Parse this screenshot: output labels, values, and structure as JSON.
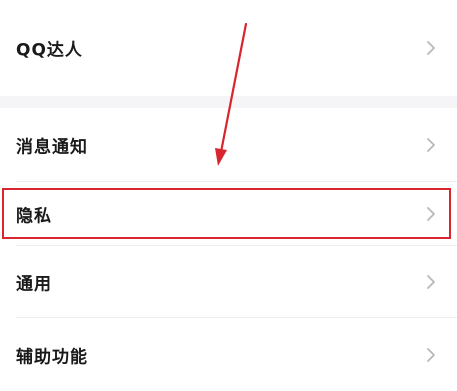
{
  "settings": {
    "items": [
      {
        "label": "QQ达人",
        "icon": "chevron-right-icon"
      },
      {
        "label": "消息通知",
        "icon": "chevron-right-icon"
      },
      {
        "label": "隐私",
        "icon": "chevron-right-icon",
        "highlighted": true
      },
      {
        "label": "通用",
        "icon": "chevron-right-icon"
      },
      {
        "label": "辅助功能",
        "icon": "chevron-right-icon"
      }
    ]
  },
  "annotation": {
    "color": "#d8252e",
    "target": "隐私"
  }
}
